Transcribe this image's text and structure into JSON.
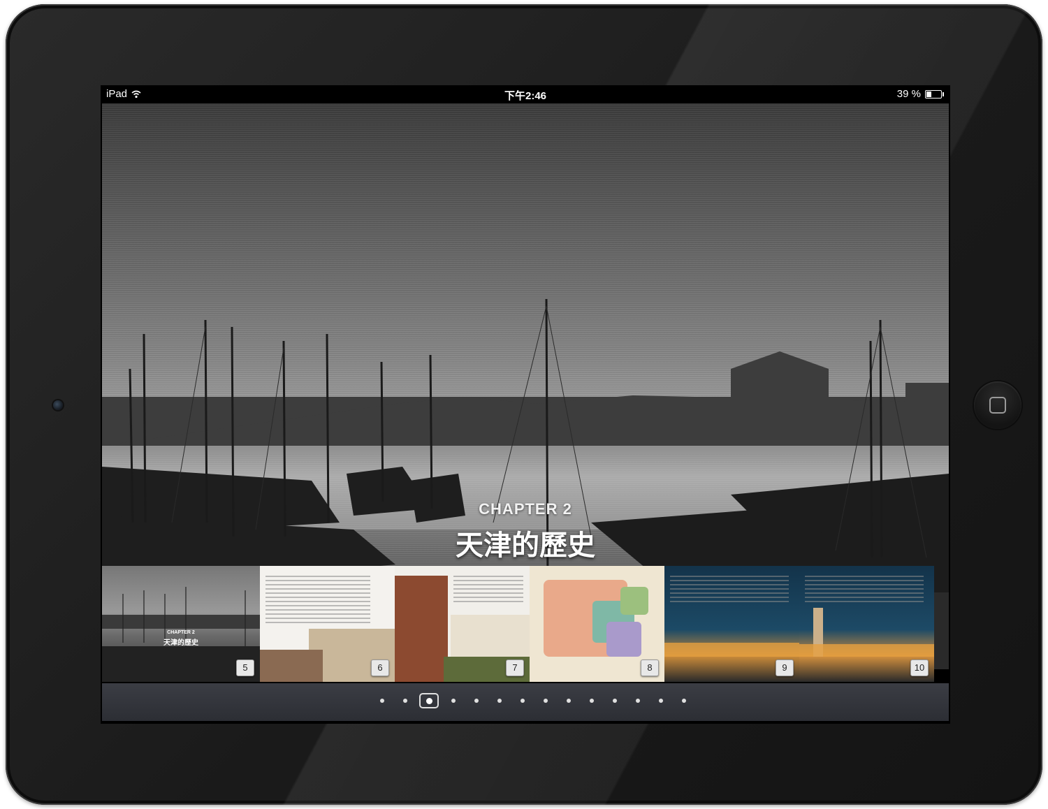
{
  "status_bar": {
    "device": "iPad",
    "time": "下午2:46",
    "battery": "39 %",
    "battery_level": 0.39
  },
  "hero": {
    "chapter_label": "CHAPTER 2",
    "chapter_title": "天津的歷史"
  },
  "thumbnails": [
    {
      "page": "5",
      "chapter_label": "CHAPTER 2",
      "title": "天津的歷史"
    },
    {
      "page": "6"
    },
    {
      "page": "7"
    },
    {
      "page": "8"
    },
    {
      "page": "9"
    },
    {
      "page": "10"
    }
  ],
  "pager": {
    "total_dots": 14,
    "active_index": 2
  }
}
